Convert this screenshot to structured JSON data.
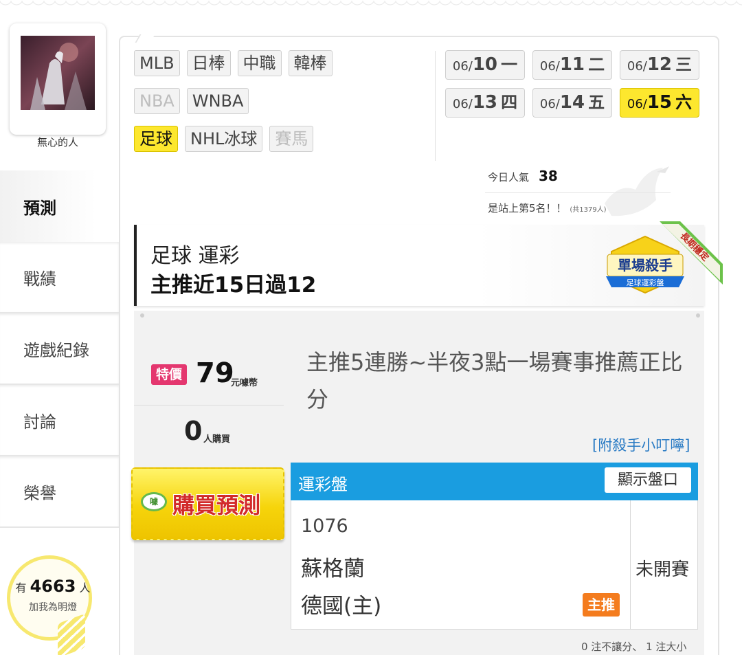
{
  "user": {
    "name": "無心的人"
  },
  "nav": {
    "items": [
      {
        "label": "預測",
        "active": true
      },
      {
        "label": "戰績"
      },
      {
        "label": "遊戲紀錄"
      },
      {
        "label": "討論"
      },
      {
        "label": "榮譽"
      }
    ]
  },
  "fans": {
    "prefix": "有",
    "count": "4663",
    "suffix": "人",
    "caption": "加我為明燈"
  },
  "sports": {
    "row1": [
      "MLB",
      "日棒",
      "中職",
      "韓棒"
    ],
    "row2": [
      "NBA",
      "WNBA"
    ],
    "row3": [
      "足球",
      "NHL冰球",
      "賽馬"
    ]
  },
  "dates": [
    {
      "month": "06/",
      "day": "10",
      "weekday": "一"
    },
    {
      "month": "06/",
      "day": "11",
      "weekday": "二"
    },
    {
      "month": "06/",
      "day": "12",
      "weekday": "三"
    },
    {
      "month": "06/",
      "day": "13",
      "weekday": "四"
    },
    {
      "month": "06/",
      "day": "14",
      "weekday": "五"
    },
    {
      "month": "06/",
      "day": "15",
      "weekday": "六",
      "active": true
    }
  ],
  "popularity": {
    "label": "今日人氣",
    "value": "38",
    "rank_text": "是站上第5名！！",
    "total_text": "(共1379人)"
  },
  "header": {
    "category": "足球 運彩",
    "record": "主推近15日過12",
    "badge_title": "單場殺手",
    "badge_sub": "足球運彩盤",
    "ribbon": "長期穩定"
  },
  "offer": {
    "tag": "特價",
    "price": "79",
    "price_unit": "元噱幣",
    "buyers": "0",
    "buyers_unit": "人購買",
    "buy_label": "購買預測",
    "buy_icon": "噱"
  },
  "description": "主推5連勝~半夜3點一場賽事推薦正比分",
  "hint_link": "[附殺手小叮嚀]",
  "odds": {
    "title": "運彩盤",
    "show_button": "顯示盤口",
    "match_id": "1076",
    "away_team": "蘇格蘭",
    "home_team": "德國(主)",
    "pick_tag": "主推",
    "status": "未開賽",
    "footnote": "0 注不讓分、 1 注大小"
  },
  "colors": {
    "accent_yellow": "#fde72e",
    "odds_blue": "#1a9de0",
    "special_pink": "#e4376f",
    "pick_orange": "#f47c1e",
    "link_blue": "#2a7bc4"
  }
}
